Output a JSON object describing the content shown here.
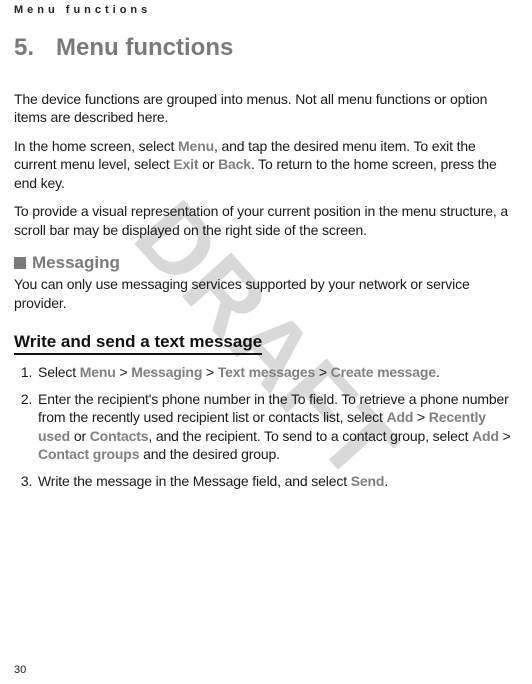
{
  "running_head": "Menu functions",
  "watermark": "DRAFT",
  "page_number": "30",
  "chapter": {
    "number": "5.",
    "title": "Menu functions"
  },
  "intro": {
    "p1": "The device functions are grouped into menus. Not all menu functions or option items are described here.",
    "p2_a": "In the home screen, select ",
    "p2_menu": "Menu",
    "p2_b": ", and tap the desired menu item. To exit the current menu level, select ",
    "p2_exit": "Exit",
    "p2_c": " or ",
    "p2_back": "Back",
    "p2_d": ". To return to the home screen, press the end key.",
    "p3": "To provide a visual representation of your current position in the menu structure, a scroll bar may be displayed on the right side of the screen."
  },
  "section": {
    "title": "Messaging",
    "p1": "You can only use messaging services supported by your network or service provider."
  },
  "subhead": "Write and send a text message",
  "steps": {
    "s1_a": "Select ",
    "s1_menu": "Menu",
    "s1_gt1": " > ",
    "s1_messaging": "Messaging",
    "s1_gt2": " > ",
    "s1_text": "Text messages",
    "s1_gt3": " > ",
    "s1_create": "Create message",
    "s1_end": ".",
    "s2_a": "Enter the recipient's phone number in the To field. To retrieve a phone number from the recently used recipient list or contacts list, select ",
    "s2_add1": "Add",
    "s2_gt1": " > ",
    "s2_recent": "Recently used",
    "s2_or": " or ",
    "s2_contacts": "Contacts",
    "s2_b": ", and the recipient. To send to a contact group, select ",
    "s2_add2": "Add",
    "s2_gt2": " > ",
    "s2_groups": "Contact groups",
    "s2_c": " and the desired group.",
    "s3_a": "Write the message in the Message field, and select ",
    "s3_send": "Send",
    "s3_end": "."
  }
}
